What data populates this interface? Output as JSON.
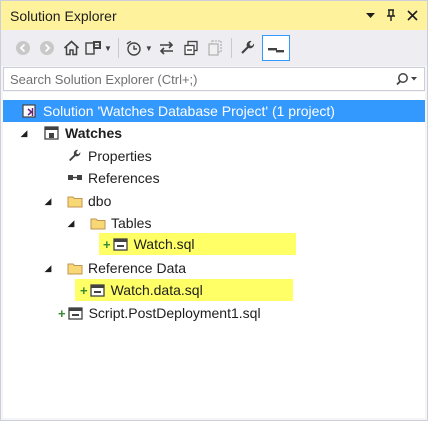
{
  "window": {
    "title": "Solution Explorer",
    "accent": "#fff29d"
  },
  "search": {
    "placeholder": "Search Solution Explorer (Ctrl+;)"
  },
  "tree": {
    "solution": "Solution 'Watches Database Project' (1 project)",
    "project": "Watches",
    "properties": "Properties",
    "references": "References",
    "dbo": "dbo",
    "tables": "Tables",
    "watch_sql": "Watch.sql",
    "reference_data": "Reference Data",
    "watch_data_sql": "Watch.data.sql",
    "script_post": "Script.PostDeployment1.sql"
  },
  "colors": {
    "selection": "#3399ff",
    "highlight": "#ffff66",
    "added": "#388a34"
  }
}
